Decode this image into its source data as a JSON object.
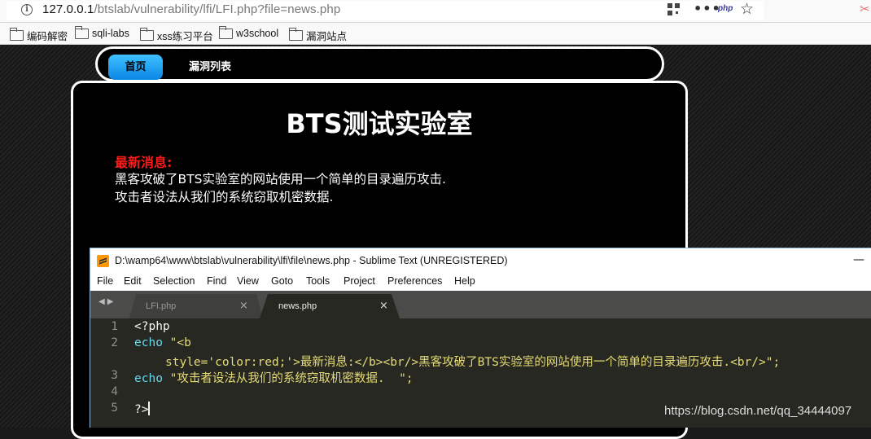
{
  "browser": {
    "url_host": "127.0.0.1",
    "url_path": "/btslab/vulnerability/lfi/LFI.php?file=news.php",
    "icons": [
      "info-icon",
      "qr-code-icon",
      "more-icon",
      "php-icon",
      "bookmark-star-icon",
      "screenshot-icon"
    ],
    "php_label": "php",
    "bookmarks": [
      "编码解密",
      "sqli-labs",
      "xss练习平台",
      "w3school",
      "漏洞站点"
    ]
  },
  "page": {
    "nav": {
      "home": "首页",
      "vuln_list": "漏洞列表"
    },
    "title": "BTS测试实验室",
    "news_label": "最新消息:",
    "news_line1": "黑客攻破了BTS实验室的网站使用一个简单的目录遍历攻击.",
    "news_line2": "攻击者设法从我们的系统窃取机密数据."
  },
  "sublime": {
    "window_title": "D:\\wamp64\\www\\btslab\\vulnerability\\lfi\\file\\news.php - Sublime Text (UNREGISTERED)",
    "menu": [
      "File",
      "Edit",
      "Selection",
      "Find",
      "View",
      "Goto",
      "Tools",
      "Project",
      "Preferences",
      "Help"
    ],
    "tabs": [
      {
        "label": "LFI.php",
        "active": false
      },
      {
        "label": "news.php",
        "active": true
      }
    ],
    "line_numbers": [
      "1",
      "2",
      "3",
      "4",
      "5"
    ],
    "code": {
      "l1": "<?php",
      "l2_kw": "echo",
      "l2_a": "\"<b",
      "l2_b": "style='color:red;'>最新消息:</b><br/>黑客攻破了BTS实验室的网站使用一个简单的目录遍历攻击.<br/>\";",
      "l3_kw": "echo",
      "l3_str": "\"攻击者设法从我们的系统窃取机密数据.  \";",
      "l5": "?>"
    },
    "colors": {
      "background": "#272822",
      "keyword": "#66d9ef",
      "string": "#e6db74"
    }
  },
  "watermark": "https://blog.csdn.net/qq_34444097"
}
